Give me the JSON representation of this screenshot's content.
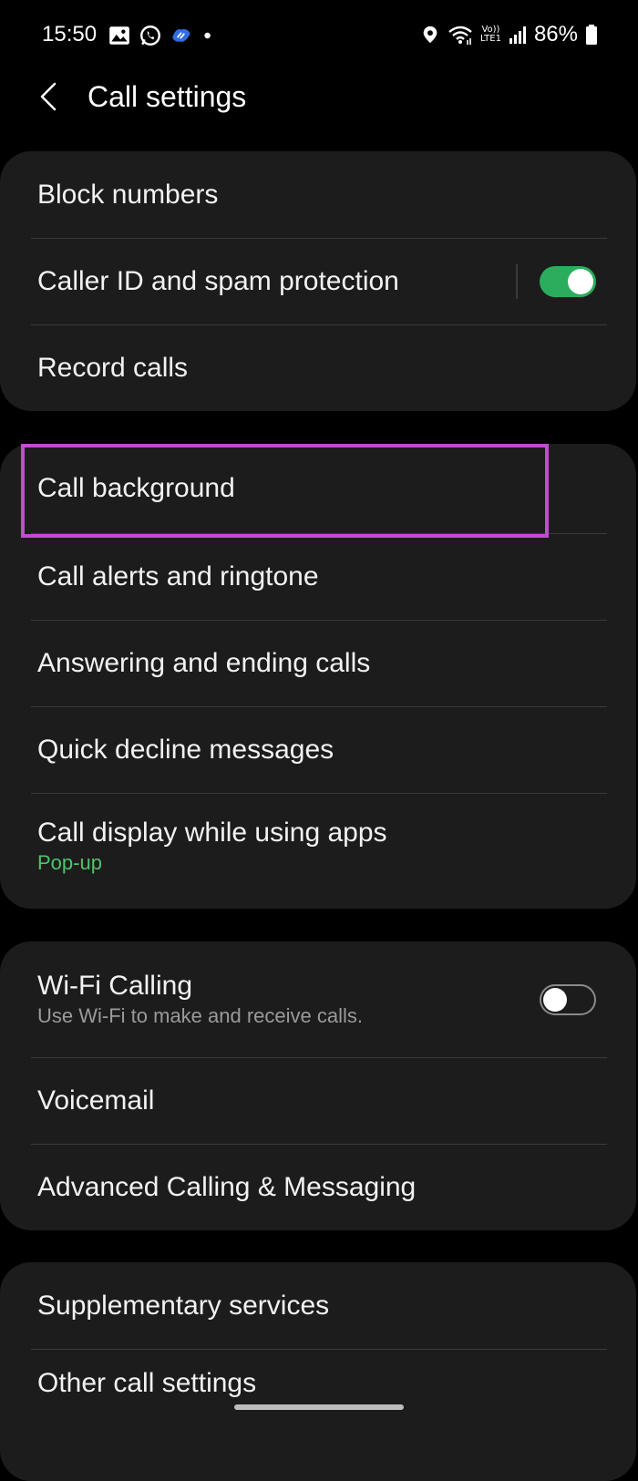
{
  "status_bar": {
    "time": "15:50",
    "left_icons": [
      "image-icon",
      "whatsapp-icon",
      "app-icon",
      "dot-icon"
    ],
    "right_icons": [
      "location-icon",
      "wifi-icon",
      "volte-icon",
      "signal-icon",
      "battery-icon"
    ],
    "volte_top": "Vo))",
    "volte_bottom": "LTE1",
    "battery": "86%"
  },
  "header": {
    "title": "Call settings"
  },
  "groups": [
    {
      "items": [
        {
          "title": "Block numbers"
        },
        {
          "title": "Caller ID and spam protection",
          "toggle": true
        },
        {
          "title": "Record calls"
        }
      ]
    },
    {
      "items": [
        {
          "title": "Call background",
          "highlighted": true
        },
        {
          "title": "Call alerts and ringtone"
        },
        {
          "title": "Answering and ending calls"
        },
        {
          "title": "Quick decline messages"
        },
        {
          "title": "Call display while using apps",
          "subtitle": "Pop-up"
        }
      ]
    },
    {
      "items": [
        {
          "title": "Wi-Fi Calling",
          "subtitle": "Use Wi-Fi to make and receive calls.",
          "toggle": false
        },
        {
          "title": "Voicemail"
        },
        {
          "title": "Advanced Calling & Messaging"
        }
      ]
    },
    {
      "items": [
        {
          "title": "Supplementary services"
        },
        {
          "title": "Other call settings"
        }
      ]
    }
  ],
  "colors": {
    "background": "#000000",
    "card": "#1c1c1c",
    "accent_green": "#2aad5c",
    "subtitle_green": "#4fc36b",
    "highlight": "#c24bd1"
  }
}
